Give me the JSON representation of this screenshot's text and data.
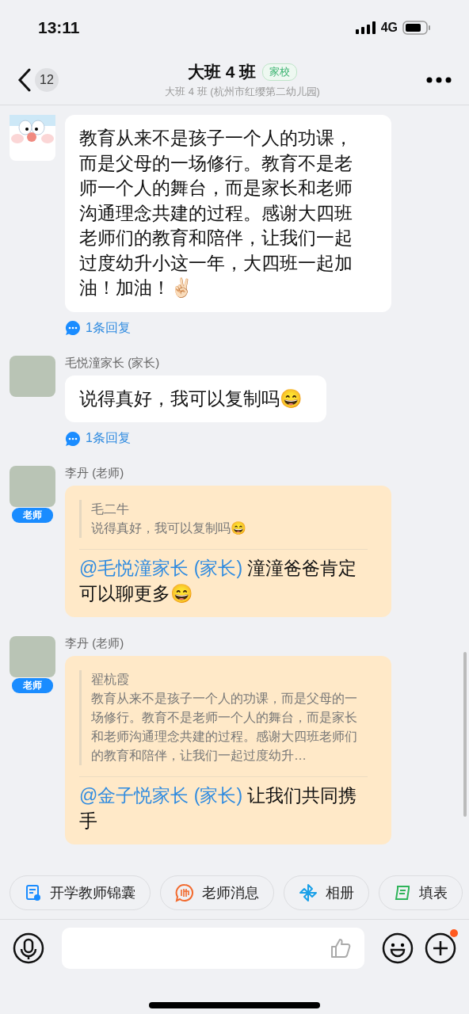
{
  "status_bar": {
    "time": "13:11",
    "network": "4G"
  },
  "header": {
    "back_count": "12",
    "title": "大班 4 班",
    "tag": "家校",
    "subtitle": "大班 4 班 (杭州市红缨第二幼儿园)"
  },
  "messages": [
    {
      "kind": "parent",
      "avatar": {
        "kind": "cartoon"
      },
      "text": "教育从来不是孩子一个人的功课，而是父母的一场修行。教育不是老师一个人的舞台，而是家长和老师沟通理念共建的过程。感谢大四班老师们的教育和陪伴，让我们一起过度幼升小这一年，大四班一起加油！加油！✌🏻",
      "reply": "1条回复"
    },
    {
      "kind": "parent",
      "sender": "毛悦潼家长 (家长)",
      "avatar": {
        "kind": "photo"
      },
      "text": "说得真好，我可以复制吗😄",
      "reply": "1条回复"
    },
    {
      "kind": "teacher",
      "sender": "李丹 (老师)",
      "avatar": {
        "kind": "photo"
      },
      "role_badge": "老师",
      "quote": {
        "author": "毛二牛",
        "text": "说得真好，我可以复制吗😄"
      },
      "mention": "@毛悦潼家长 (家长)",
      "text": " 潼潼爸爸肯定可以聊更多😄"
    },
    {
      "kind": "teacher",
      "sender": "李丹 (老师)",
      "avatar": {
        "kind": "photo"
      },
      "role_badge": "老师",
      "quote": {
        "author": "翟杭霞",
        "text": "教育从来不是孩子一个人的功课，而是父母的一场修行。教育不是老师一个人的舞台，而是家长和老师沟通理念共建的过程。感谢大四班老师们的教育和陪伴，让我们一起过度幼升…"
      },
      "mention": "@金子悦家长 (家长)",
      "text": " 让我们共同携手"
    }
  ],
  "shortcuts": [
    {
      "kind": "kit",
      "label": "开学教师锦囊"
    },
    {
      "kind": "teacher",
      "label": "老师消息"
    },
    {
      "kind": "album",
      "label": "相册"
    },
    {
      "kind": "form",
      "label": "填表"
    }
  ],
  "composer": {
    "plus_badge": true
  }
}
